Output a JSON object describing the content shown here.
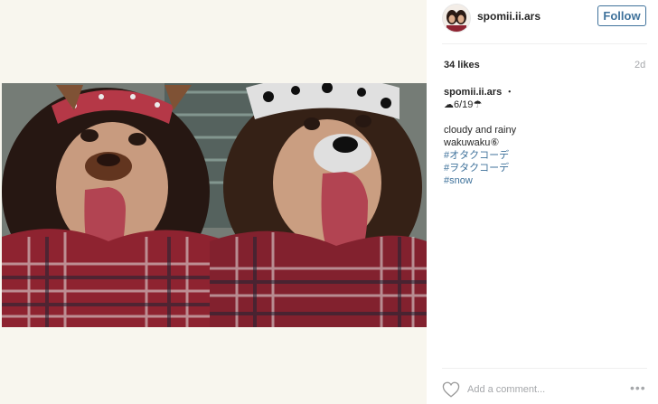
{
  "post": {
    "username": "spomii.ii.ars",
    "follow_label": "Follow",
    "likes": "34 likes",
    "age": "2d",
    "caption_user": "spomii.ii.ars",
    "caption_dot": "・",
    "caption_date": "☁6/19☂",
    "caption_lines": [
      "cloudy and rainy",
      "wakuwaku⑥"
    ],
    "hashtags": [
      "#オタクコーデ",
      "#ヲタクコーデ",
      "#snow"
    ]
  },
  "comment": {
    "placeholder": "Add a comment..."
  },
  "icons": {
    "like": "heart-outline-icon",
    "more": "more-options-icon"
  },
  "colors": {
    "link": "#3f729b",
    "muted": "#a5a7aa",
    "divider": "#efefef"
  }
}
